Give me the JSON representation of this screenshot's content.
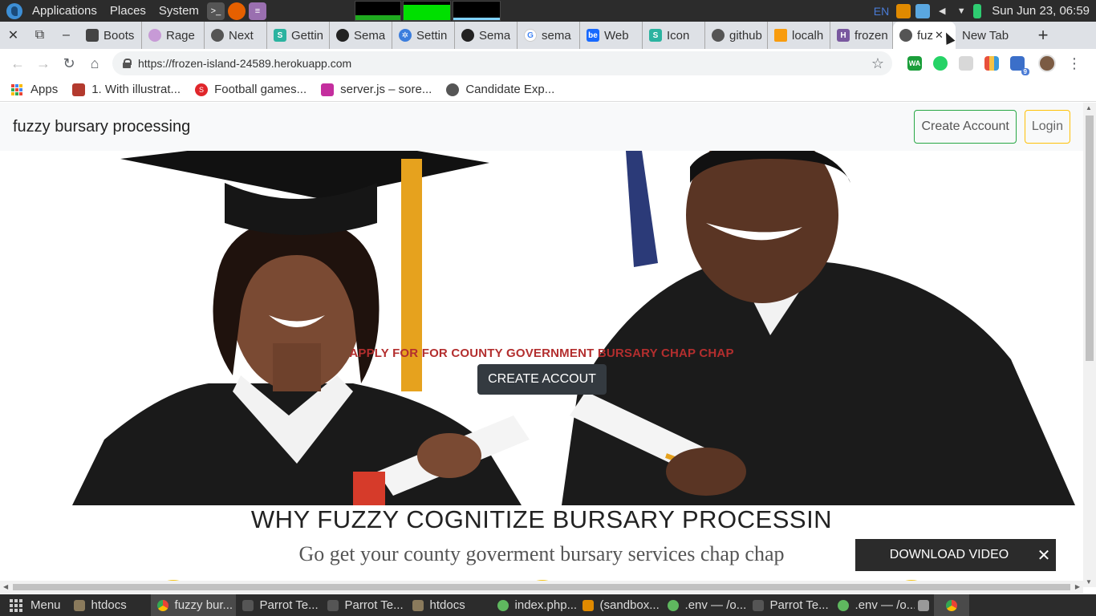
{
  "system_panel": {
    "menus": [
      "Applications",
      "Places",
      "System"
    ],
    "clock": "Sun Jun 23, 06:59",
    "keyboard_layout": "EN",
    "launchers": [
      "terminal-icon",
      "firefox-icon",
      "text-editor-icon"
    ],
    "tray_icons": [
      "vlc-icon",
      "clipboard-icon",
      "volume-icon",
      "wifi-icon",
      "battery-icon"
    ]
  },
  "browser": {
    "tabs": [
      {
        "title": "Boots",
        "icon": "bootstrap-icon"
      },
      {
        "title": "Rage",
        "icon": "rage-icon"
      },
      {
        "title": "Next",
        "icon": "globe-icon"
      },
      {
        "title": "Gettin",
        "icon": "semaphore-icon"
      },
      {
        "title": "Sema",
        "icon": "github-icon"
      },
      {
        "title": "Settin",
        "icon": "gear-icon"
      },
      {
        "title": "Sema",
        "icon": "github-icon"
      },
      {
        "title": "sema",
        "icon": "google-icon"
      },
      {
        "title": "Web",
        "icon": "behance-icon"
      },
      {
        "title": "Icon",
        "icon": "semaphore-icon"
      },
      {
        "title": "github",
        "icon": "globe-icon"
      },
      {
        "title": "localh",
        "icon": "phpmyadmin-icon"
      },
      {
        "title": "frozen",
        "icon": "heroku-icon"
      },
      {
        "title": "fuz",
        "icon": "globe-icon",
        "active": true
      },
      {
        "title": "New Tab",
        "icon": ""
      }
    ],
    "url": "https://frozen-island-24589.herokuapp.com",
    "extensions": [
      {
        "label": "WA",
        "color": "#1a9e3a"
      },
      {
        "label": "",
        "color": "#25d366"
      },
      {
        "label": "",
        "color": "#d8d8d8"
      },
      {
        "label": "",
        "color": "#e8503a"
      },
      {
        "label": "",
        "color": "#3b6fc9",
        "badge": "9"
      }
    ],
    "bookmarks": [
      {
        "label": "Apps",
        "icon": "apps-grid-icon"
      },
      {
        "label": "1. With illustrat...",
        "icon": "bookmark-red-icon"
      },
      {
        "label": "Football games...",
        "icon": "football-icon"
      },
      {
        "label": "server.js – sore...",
        "icon": "glitch-icon"
      },
      {
        "label": "Candidate Exp...",
        "icon": "globe-icon"
      }
    ]
  },
  "site": {
    "brand": "fuzzy bursary processing",
    "nav_buttons": {
      "create_account": "Create Account",
      "login": "Login"
    },
    "hero": {
      "title": "APPLY FOR FOR COUNTY GOVERNMENT BURSARY CHAP CHAP",
      "cta": "CREATE ACCOUT"
    },
    "why_title": "WHY FUZZY COGNITIZE BURSARY PROCESSIN",
    "why_subtitle": "Go get your county goverment bursary services chap chap",
    "download_video": {
      "label": "DOWNLOAD VIDEO",
      "close": "✕"
    }
  },
  "taskbar": {
    "menu": "Menu",
    "items": [
      {
        "label": "htdocs",
        "icon": "folder-icon"
      },
      {
        "label": "fuzzy bur...",
        "icon": "chrome-icon",
        "active": true
      },
      {
        "label": "Parrot Te...",
        "icon": "terminal-icon"
      },
      {
        "label": "Parrot Te...",
        "icon": "terminal-icon"
      },
      {
        "label": "htdocs",
        "icon": "folder-icon"
      },
      {
        "label": "index.php...",
        "icon": "atom-icon"
      },
      {
        "label": "(sandbox...",
        "icon": "vlc-icon"
      },
      {
        "label": ".env — /o...",
        "icon": "atom-icon"
      },
      {
        "label": "Parrot Te...",
        "icon": "terminal-icon"
      },
      {
        "label": ".env — /o...",
        "icon": "atom-icon"
      }
    ]
  },
  "colors": {
    "hero_title": "#b32e2e",
    "cta_bg": "#343a40",
    "create_account_border": "#28a745",
    "login_border": "#ffc107",
    "accent_yellow": "#f5c518"
  }
}
